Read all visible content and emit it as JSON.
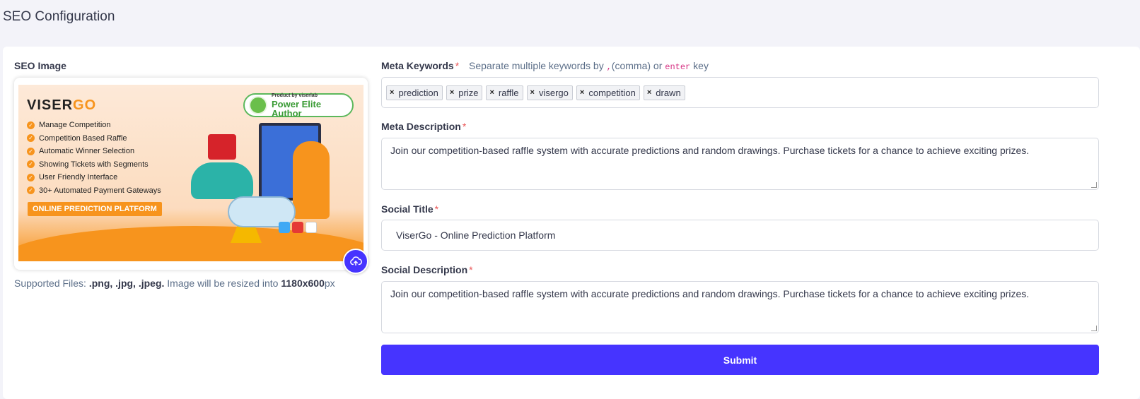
{
  "page": {
    "title": "SEO Configuration"
  },
  "seo_image": {
    "label": "SEO Image",
    "supported_prefix": "Supported Files:",
    "supported_types": ".png, .jpg, .jpeg.",
    "resize_text": "Image will be resized into",
    "resize_size": "1180x600",
    "resize_unit": "px",
    "preview": {
      "brand_main": "VISER",
      "brand_accent": "GO",
      "features": [
        "Manage Competition",
        "Competition Based Raffle",
        "Automatic Winner Selection",
        "Showing Tickets with Segments",
        "User Friendly Interface",
        "30+ Automated Payment Gateways"
      ],
      "platform_badge": "ONLINE PREDICTION PLATFORM",
      "author_small": "Product by viserlab",
      "author_big": "Power Elite Author"
    },
    "upload_icon": "cloud-upload-icon"
  },
  "meta_keywords": {
    "label": "Meta Keywords",
    "required_mark": "*",
    "hint_before": "Separate multiple keywords by",
    "hint_comma_code": ",",
    "hint_comma_text": "(comma) or",
    "hint_enter_code": "enter",
    "hint_after": "key",
    "tags": [
      "prediction",
      "prize",
      "raffle",
      "visergo",
      "competition",
      "drawn"
    ],
    "tag_remove": "×"
  },
  "meta_description": {
    "label": "Meta Description",
    "required_mark": "*",
    "value": "Join our competition-based raffle system with accurate predictions and random drawings. Purchase tickets for a chance to achieve exciting prizes."
  },
  "social_title": {
    "label": "Social Title",
    "required_mark": "*",
    "value": "ViserGo - Online Prediction Platform"
  },
  "social_description": {
    "label": "Social Description",
    "required_mark": "*",
    "value": "Join our competition-based raffle system with accurate predictions and random drawings. Purchase tickets for a chance to achieve exciting prizes."
  },
  "submit": {
    "label": "Submit"
  },
  "colors": {
    "primary": "#4634ff",
    "required": "#ea5455",
    "accent_orange": "#f7941d"
  }
}
